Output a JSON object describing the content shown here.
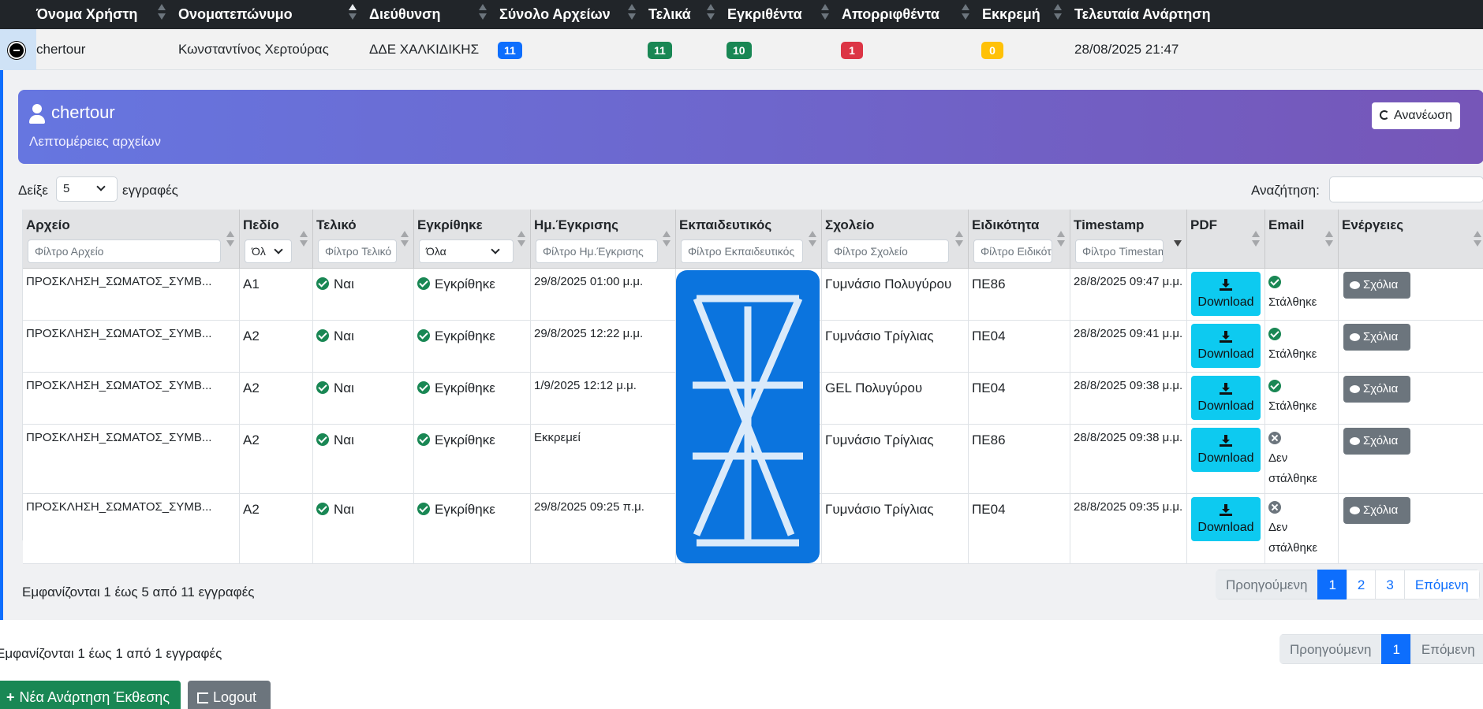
{
  "outer_table": {
    "headers": [
      "Όνομα Χρήστη",
      "Ονοματεπώνυμο",
      "Διεύθυνση",
      "Σύνολο Αρχείων",
      "Τελικά",
      "Εγκριθέντα",
      "Απορριφθέντα",
      "Εκκρεμή",
      "Τελευταία Ανάρτηση"
    ],
    "row": {
      "username": "chertour",
      "fullname": "Κωνσταντίνος Χερτούρας",
      "address": "ΔΔΕ ΧΑΛΚΙΔΙΚΗΣ",
      "total": "11",
      "final": "11",
      "approved": "10",
      "rejected": "1",
      "pending": "0",
      "last_post": "28/08/2025 21:47"
    }
  },
  "detail": {
    "title": "chertour",
    "subtitle": "Λεπτομέρειες αρχείων",
    "refresh_label": "Ανανέωση",
    "show_label": "Δείξε",
    "show_value": "5",
    "show_suffix": "εγγραφές",
    "search_label": "Αναζήτηση:",
    "search_value": "",
    "columns": [
      "Αρχείο",
      "Πεδίο",
      "Τελικό",
      "Εγκρίθηκε",
      "Ημ.Έγκρισης",
      "Εκπαιδευτικός",
      "Σχολείο",
      "Ειδικότητα",
      "Timestamp",
      "PDF",
      "Email",
      "Ενέργειες"
    ],
    "filters": {
      "file": "Φίλτρο Αρχείο",
      "field": "Όλ",
      "final": "Φίλτρο Τελικό",
      "approved": "Όλα",
      "approval_date": "Φίλτρο Ημ.Έγκρισης",
      "teacher": "Φίλτρο Εκπαιδευτικός",
      "school": "Φίλτρο Σχολείο",
      "specialty": "Φίλτρο Ειδικότητα",
      "timestamp": "Φίλτρο Timestamp"
    },
    "rows": [
      {
        "file": "ΠΡΟΣΚΛΗΣΗ_ΣΩΜΑΤΟΣ_ΣΥΜΒ...",
        "field": "Α1",
        "final": "Ναι",
        "approved": "Εγκρίθηκε",
        "approval_date": "29/8/2025 01:00 μ.μ.",
        "school": "Γυμνάσιο Πολυγύρου",
        "specialty": "ΠΕ86",
        "timestamp": "28/8/2025 09:47 μ.μ.",
        "pdf": "Download",
        "email": "Στάλθηκε",
        "action": "Σχόλια"
      },
      {
        "file": "ΠΡΟΣΚΛΗΣΗ_ΣΩΜΑΤΟΣ_ΣΥΜΒ...",
        "field": "Α2",
        "final": "Ναι",
        "approved": "Εγκρίθηκε",
        "approval_date": "29/8/2025 12:22 μ.μ.",
        "school": "Γυμνάσιο Τρίγλιας",
        "specialty": "ΠΕ04",
        "timestamp": "28/8/2025 09:41 μ.μ.",
        "pdf": "Download",
        "email": "Στάλθηκε",
        "action": "Σχόλια"
      },
      {
        "file": "ΠΡΟΣΚΛΗΣΗ_ΣΩΜΑΤΟΣ_ΣΥΜΒ...",
        "field": "Α2",
        "final": "Ναι",
        "approved": "Εγκρίθηκε",
        "approval_date": "1/9/2025 12:12 μ.μ.",
        "school": "GEL Πολυγύρου",
        "specialty": "ΠΕ04",
        "timestamp": "28/8/2025 09:38 μ.μ.",
        "pdf": "Download",
        "email": "Στάλθηκε",
        "action": "Σχόλια"
      },
      {
        "file": "ΠΡΟΣΚΛΗΣΗ_ΣΩΜΑΤΟΣ_ΣΥΜΒ...",
        "field": "Α2",
        "final": "Ναι",
        "approved": "Εγκρίθηκε",
        "approval_date": "Εκκρεμεί",
        "school": "Γυμνάσιο Τρίγλιας",
        "specialty": "ΠΕ86",
        "timestamp": "28/8/2025 09:38 μ.μ.",
        "pdf": "Download",
        "email": "Δεν στάλθηκε",
        "action": "Σχόλια"
      },
      {
        "file": "ΠΡΟΣΚΛΗΣΗ_ΣΩΜΑΤΟΣ_ΣΥΜΒ...",
        "field": "Α2",
        "final": "Ναι",
        "approved": "Εγκρίθηκε",
        "approval_date": "29/8/2025 09:25 π.μ.",
        "school": "Γυμνάσιο Τρίγλιας",
        "specialty": "ΠΕ04",
        "timestamp": "28/8/2025 09:35 μ.μ.",
        "pdf": "Download",
        "email": "Δεν στάλθηκε",
        "action": "Σχόλια"
      }
    ],
    "info": "Εμφανίζονται 1 έως 5 από 11 εγγραφές",
    "pagination": {
      "prev": "Προηγούμενη",
      "pages": [
        "1",
        "2",
        "3"
      ],
      "next": "Επόμενη"
    }
  },
  "outer_footer": {
    "info": "Εμφανίζονται 1 έως 1 από 1 εγγραφές",
    "pagination": {
      "prev": "Προηγούμενη",
      "page": "1",
      "next": "Επόμενη"
    }
  },
  "actions": {
    "new_post": "Νέα Ανάρτηση Έκθεσης",
    "logout": "Logout"
  },
  "colors": {
    "primary": "#0d6efd",
    "success": "#198754",
    "danger": "#dc3545",
    "warning": "#ffc107",
    "info": "#0dcaf0",
    "secondary": "#6c757d",
    "redaction": "#0b74de"
  }
}
